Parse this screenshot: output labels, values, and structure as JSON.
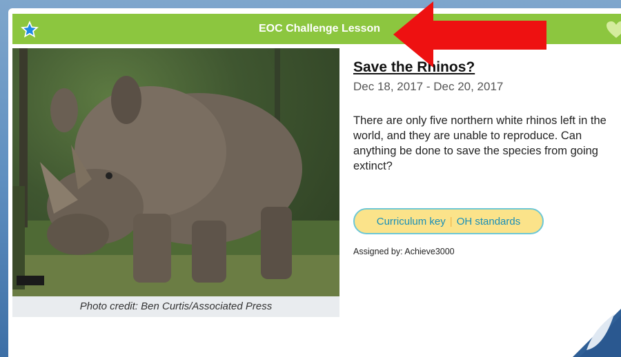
{
  "header": {
    "title": "EOC Challenge Lesson"
  },
  "lesson": {
    "title": "Save the Rhinos?",
    "dates": "Dec 18, 2017 - Dec 20, 2017",
    "description": "There are only five northern white rhinos left in the world, and they are unable to reproduce. Can anything be done to save the species from going extinct?",
    "photo_credit": "Photo credit: Ben Curtis/Associated Press",
    "curriculum_key": "Curriculum key",
    "separator": "|",
    "standards": "OH standards",
    "assigned_by": "Assigned by: Achieve3000"
  },
  "icons": {
    "favorite": "star-icon",
    "like": "heart-icon"
  },
  "colors": {
    "header_green": "#8cc63f",
    "star_blue": "#1e88e5",
    "pill_yellow": "#fbe38a",
    "pill_border": "#6cc7d6",
    "link_blue": "#1a8fb8",
    "arrow_red": "#ee1111"
  }
}
